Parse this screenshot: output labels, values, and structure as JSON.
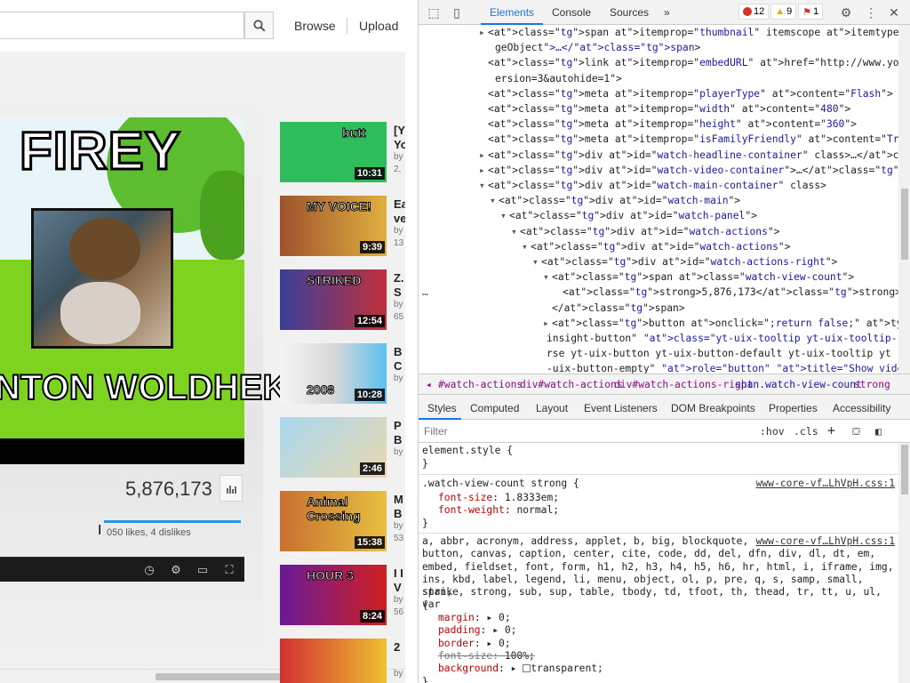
{
  "page": {
    "search": {
      "placeholder": "",
      "value": ""
    },
    "masthead": {
      "browse": "Browse",
      "upload": "Upload"
    },
    "video": {
      "thumb_title_top": "FIREY",
      "thumb_title_bottom": "NTON WOLDHEK",
      "view_count": "5,876,173",
      "likes_text": "050 likes, 4 dislikes",
      "like_ratio": 0.99
    },
    "related": [
      {
        "title": "[Y",
        "title2": "Yo",
        "by": "by",
        "views": "2,",
        "duration": "10:31",
        "thumb_text": "butt"
      },
      {
        "title": "Ea",
        "title2": "ve",
        "by": "by",
        "views": "13",
        "duration": "9:39",
        "thumb_text": "MY VOICE!"
      },
      {
        "title": "Z.",
        "title2": "S",
        "by": "by",
        "views": "65",
        "duration": "12:54",
        "thumb_text": "STRIKED"
      },
      {
        "title": "B",
        "title2": "C",
        "by": "by",
        "views": "",
        "duration": "10:28",
        "thumb_text": "2008"
      },
      {
        "title": "P",
        "title2": "B",
        "by": "by",
        "views": "",
        "duration": "2:46",
        "thumb_text": ""
      },
      {
        "title": "M",
        "title2": "B",
        "by": "by",
        "views": "53",
        "duration": "15:38",
        "thumb_text": "Animal Crossing"
      },
      {
        "title": "I I",
        "title2": "V",
        "by": "by",
        "views": "56",
        "duration": "8:24",
        "thumb_text": "HOUR 3"
      },
      {
        "title": "2",
        "title2": "",
        "by": "by",
        "views": "",
        "duration": "",
        "thumb_text": ""
      }
    ]
  },
  "devtools": {
    "tabs": [
      "Elements",
      "Console",
      "Sources",
      "»"
    ],
    "badges": {
      "errors": "12",
      "warnings": "9",
      "issues": "1"
    },
    "dom_lines": [
      {
        "indent": 0,
        "arrow": "▸",
        "text": "<span itemprop=\"thumbnail\" itemscope itemtype=\"http://schema.org/Ima"
      },
      {
        "indent": 0,
        "arrow": "",
        "text": "geObject\">…</span>"
      },
      {
        "indent": 0,
        "arrow": "",
        "text": "<link itemprop=\"embedURL\" href=\"http://www.youtube.com/v/undefined?v"
      },
      {
        "indent": 0,
        "arrow": "",
        "text": "ersion=3&autohide=1\">"
      },
      {
        "indent": 0,
        "arrow": "",
        "text": "<meta itemprop=\"playerType\" content=\"Flash\">"
      },
      {
        "indent": 0,
        "arrow": "",
        "text": "<meta itemprop=\"width\" content=\"480\">"
      },
      {
        "indent": 0,
        "arrow": "",
        "text": "<meta itemprop=\"height\" content=\"360\">"
      },
      {
        "indent": 0,
        "arrow": "",
        "text": "<meta itemprop=\"isFamilyFriendly\" content=\"True\">"
      },
      {
        "indent": 0,
        "arrow": "▸",
        "text": "<div id=\"watch-headline-container\" class>…</div>"
      },
      {
        "indent": 0,
        "arrow": "▸",
        "text": "<div id=\"watch-video-container\">…</div>"
      },
      {
        "indent": 0,
        "arrow": "▾",
        "text": "<div id=\"watch-main-container\" class>"
      },
      {
        "indent": 1,
        "arrow": "▾",
        "text": "<div id=\"watch-main\">"
      },
      {
        "indent": 2,
        "arrow": "▾",
        "text": "<div id=\"watch-panel\">"
      },
      {
        "indent": 3,
        "arrow": "▾",
        "text": "<div id=\"watch-actions\">"
      },
      {
        "indent": 4,
        "arrow": "▾",
        "text": "<div id=\"watch-actions\">"
      },
      {
        "indent": 5,
        "arrow": "▾",
        "text": "<div id=\"watch-actions-right\">"
      },
      {
        "indent": 6,
        "arrow": "▾",
        "text": "<span class=\"watch-view-count\">"
      },
      {
        "indent": 7,
        "arrow": "",
        "text": "<strong>5,876,173</strong> == $0"
      },
      {
        "indent": 6,
        "arrow": "",
        "text": "</span>"
      },
      {
        "indent": 6,
        "arrow": "▸",
        "text": "<button onclick=\";return false;\" type=\"button\" id=\"watch-"
      },
      {
        "indent": 6,
        "arrow": "",
        "text": "insight-button\" class=\"yt-uix-tooltip yt-uix-tooltip-reve"
      },
      {
        "indent": 6,
        "arrow": "",
        "text": "rse yt-uix-button yt-uix-button-default yt-uix-tooltip yt"
      },
      {
        "indent": 6,
        "arrow": "",
        "text": "-uix-button-empty\" role=\"button\" title=\"Show video statis"
      }
    ],
    "breadcrumbs": [
      "◂",
      "#watch-actions",
      "div#watch-actions",
      "div#watch-actions-right",
      "span.watch-view-count",
      "strong"
    ],
    "sub_tabs": [
      "Styles",
      "Computed",
      "Layout",
      "Event Listeners",
      "DOM Breakpoints",
      "Properties",
      "Accessibility"
    ],
    "filter": {
      "placeholder": "Filter",
      "hov": ":hov",
      "cls": ".cls",
      "add": "+"
    },
    "styles": {
      "element_style": "element.style {",
      "close": "}",
      "rule1_selector": ".watch-view-count strong {",
      "rule1_source": "www-core-vf…LhVpH.css:1",
      "rule1_props": [
        {
          "name": "font-size",
          "value": "1.8333em;"
        },
        {
          "name": "font-weight",
          "value": "normal;"
        }
      ],
      "rule2_source": "www-core-vf…LhVpH.css:1",
      "rule2_selector_lines": [
        "a, abbr, acronym, address, applet, b, big, blockquote,",
        "button, canvas, caption, center, cite, code, dd, del, dfn, div, dl, dt, em,",
        "embed, fieldset, font, form, h1, h2, h3, h4, h5, h6, hr, html, i, iframe, img,",
        "ins, kbd, label, legend, li, menu, object, ol, p, pre, q, s, samp, small, span,",
        "strike, strong, sub, sup, table, tbody, td, tfoot, th, thead, tr, tt, u, ul, var",
        "{"
      ],
      "rule2_props": [
        {
          "name": "margin",
          "value": "0;",
          "arrow": true
        },
        {
          "name": "padding",
          "value": "0;",
          "arrow": true
        },
        {
          "name": "border",
          "value": "0;",
          "arrow": true
        },
        {
          "name": "font-size",
          "value": "100%;",
          "struck": true
        },
        {
          "name": "background",
          "value": "transparent;",
          "arrow": true,
          "swatch": true
        }
      ]
    }
  }
}
